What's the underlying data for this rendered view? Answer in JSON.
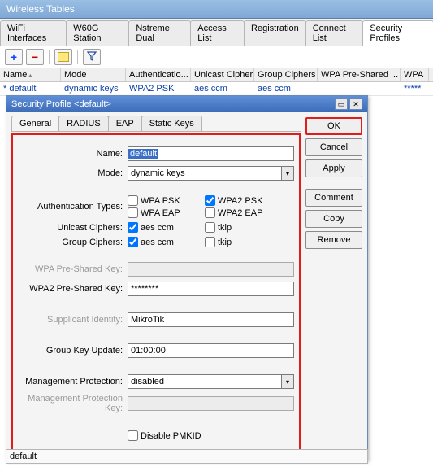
{
  "window_title": "Wireless Tables",
  "main_tabs": [
    "WiFi Interfaces",
    "W60G Station",
    "Nstreme Dual",
    "Access List",
    "Registration",
    "Connect List",
    "Security Profiles"
  ],
  "main_active_tab": 6,
  "grid": {
    "columns": [
      "Name",
      "Mode",
      "Authenticatio...",
      "Unicast Ciphers",
      "Group Ciphers",
      "WPA Pre-Shared ...",
      "WPA"
    ],
    "row": {
      "marker": "*",
      "name": "default",
      "mode": "dynamic keys",
      "auth": "WPA2 PSK",
      "unicast": "aes ccm",
      "group": "aes ccm",
      "wpa1": "",
      "wpa2": "*****"
    }
  },
  "dialog": {
    "title": "Security Profile <default>",
    "tabs": [
      "General",
      "RADIUS",
      "EAP",
      "Static Keys"
    ],
    "active_tab": 0,
    "fields": {
      "name_label": "Name:",
      "name_value": "default",
      "mode_label": "Mode:",
      "mode_value": "dynamic keys",
      "auth_label": "Authentication Types:",
      "auth_opts": {
        "wpa_psk": {
          "label": "WPA PSK",
          "checked": false
        },
        "wpa2_psk": {
          "label": "WPA2 PSK",
          "checked": true
        },
        "wpa_eap": {
          "label": "WPA EAP",
          "checked": false
        },
        "wpa2_eap": {
          "label": "WPA2 EAP",
          "checked": false
        }
      },
      "unicast_label": "Unicast Ciphers:",
      "group_label": "Group Ciphers:",
      "cipher_opts": {
        "aes": {
          "label": "aes ccm"
        },
        "tkip": {
          "label": "tkip"
        }
      },
      "unicast_aes": true,
      "unicast_tkip": false,
      "group_aes": true,
      "group_tkip": false,
      "wpa_psk_label": "WPA Pre-Shared Key:",
      "wpa_psk_value": "",
      "wpa2_psk_label": "WPA2 Pre-Shared Key:",
      "wpa2_psk_value": "********",
      "supp_label": "Supplicant Identity:",
      "supp_value": "MikroTik",
      "gku_label": "Group Key Update:",
      "gku_value": "01:00:00",
      "mp_label": "Management Protection:",
      "mp_value": "disabled",
      "mpk_label": "Management Protection Key:",
      "mpk_value": "",
      "pmkid_label": "Disable PMKID",
      "pmkid_checked": false
    },
    "buttons": {
      "ok": "OK",
      "cancel": "Cancel",
      "apply": "Apply",
      "comment": "Comment",
      "copy": "Copy",
      "remove": "Remove"
    }
  },
  "status_bar": "default"
}
